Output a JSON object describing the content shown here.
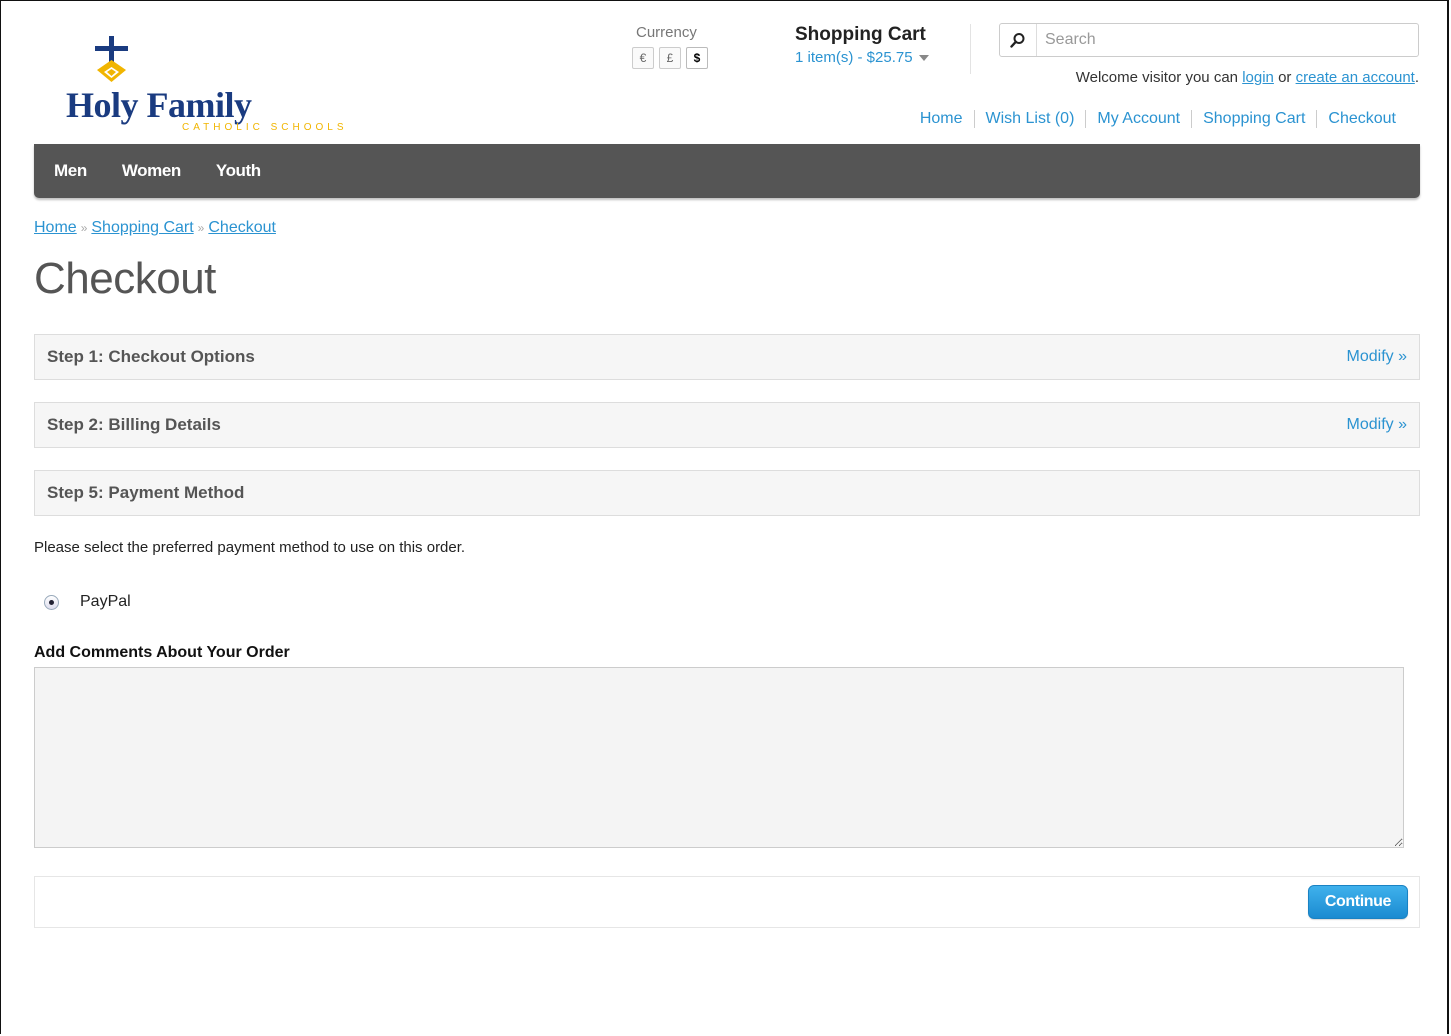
{
  "brand": {
    "name": "Holy Family",
    "subtitle": "CATHOLIC SCHOOLS",
    "colors": {
      "navy": "#1a3b80",
      "gold": "#f1b500"
    }
  },
  "currency": {
    "label": "Currency",
    "options": [
      "€",
      "£",
      "$"
    ],
    "selected": "$"
  },
  "cart": {
    "title": "Shopping Cart",
    "total": "1 item(s) - $25.75"
  },
  "search": {
    "placeholder": "Search"
  },
  "welcome": {
    "prefix": "Welcome visitor you can",
    "login": "login",
    "or": "or",
    "create": "create an account",
    "suffix": "."
  },
  "top_links": [
    "Home",
    "Wish List (0)",
    "My Account",
    "Shopping Cart",
    "Checkout"
  ],
  "menu": [
    "Men",
    "Women",
    "Youth"
  ],
  "breadcrumb": [
    "Home",
    "Shopping Cart",
    "Checkout"
  ],
  "breadcrumb_sep": "»",
  "page_title": "Checkout",
  "steps": [
    {
      "title": "Step 1: Checkout Options",
      "modify": "Modify »"
    },
    {
      "title": "Step 2: Billing Details",
      "modify": "Modify »"
    },
    {
      "title": "Step 5: Payment Method",
      "modify": ""
    }
  ],
  "payment": {
    "instructions": "Please select the preferred payment method to use on this order.",
    "method": "PayPal",
    "selected": true
  },
  "comments": {
    "label": "Add Comments About Your Order",
    "value": ""
  },
  "continue_label": "Continue",
  "colors": {
    "link": "#2b93d1",
    "menu_bg": "#555555",
    "button": "#1b8bd1"
  }
}
